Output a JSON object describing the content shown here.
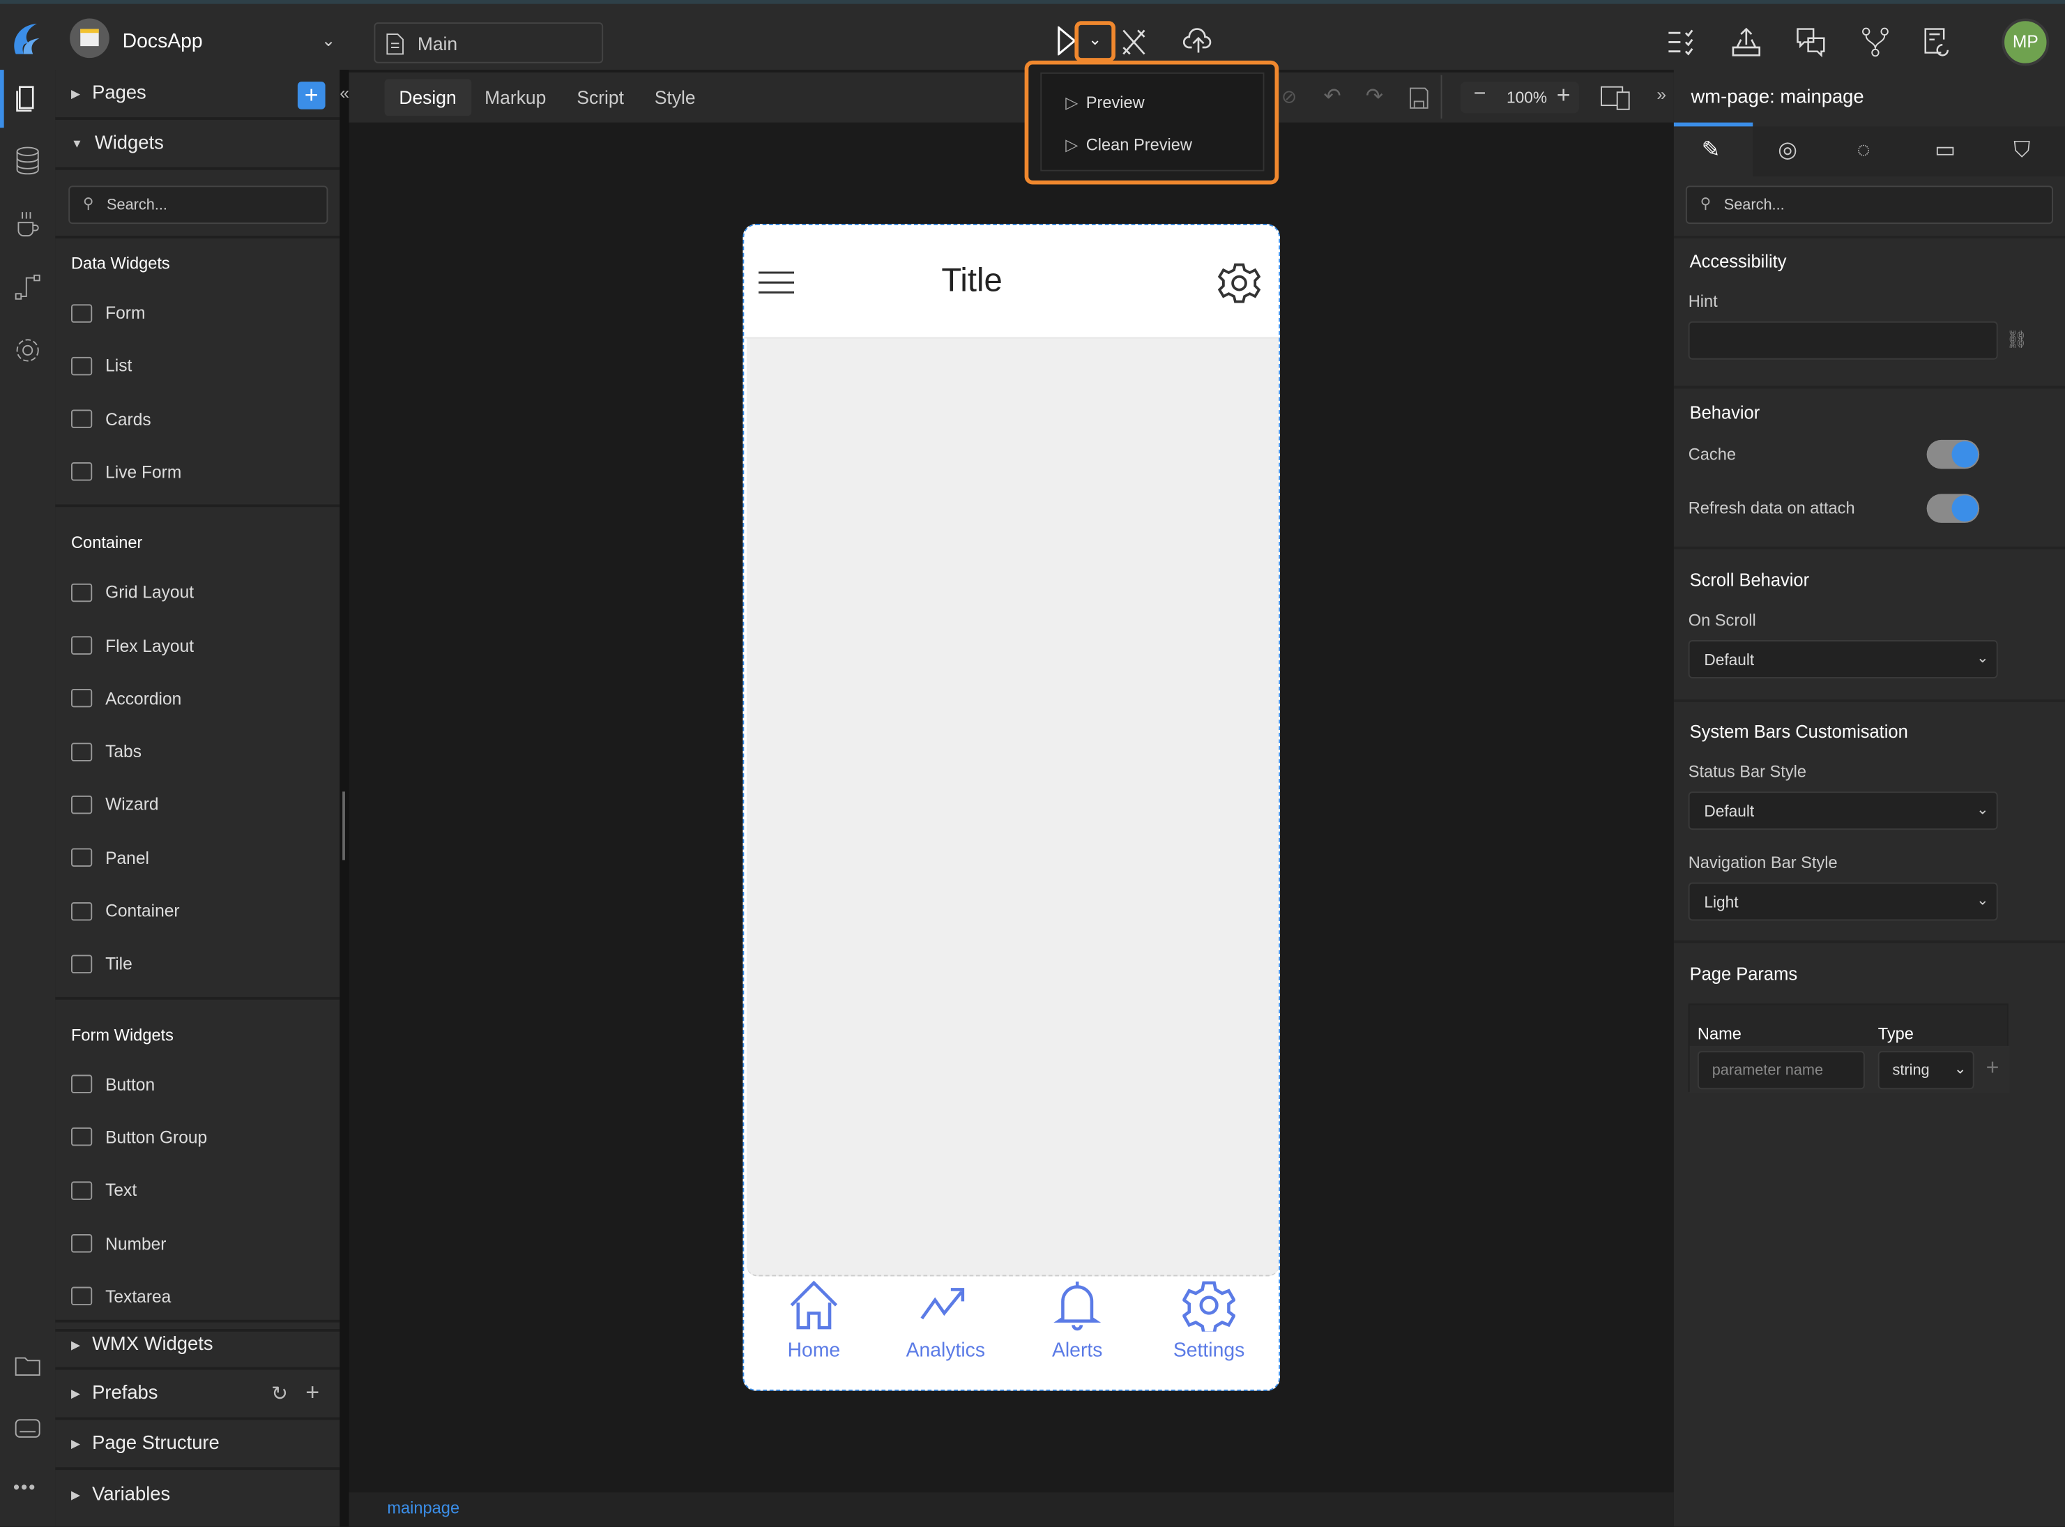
{
  "header": {
    "app_name": "DocsApp",
    "page_selector": "Main",
    "avatar_initials": "MP",
    "brand_color": "#3b8ee8",
    "avatar_color": "#6fa24f",
    "highlight_color": "#f0882e"
  },
  "preview_menu": {
    "items": [
      "Preview",
      "Clean Preview"
    ]
  },
  "left_panel": {
    "pages_label": "Pages",
    "widgets_label": "Widgets",
    "search_placeholder": "Search...",
    "groups": [
      {
        "title": "Data Widgets",
        "items": [
          "Form",
          "List",
          "Cards",
          "Live Form"
        ]
      },
      {
        "title": "Container",
        "items": [
          "Grid Layout",
          "Flex Layout",
          "Accordion",
          "Tabs",
          "Wizard",
          "Panel",
          "Container",
          "Tile"
        ]
      },
      {
        "title": "Form Widgets",
        "items": [
          "Button",
          "Button Group",
          "Text",
          "Number",
          "Textarea"
        ]
      }
    ],
    "sections": [
      "WMX Widgets",
      "Prefabs",
      "Page Structure",
      "Variables"
    ]
  },
  "editor": {
    "tabs": [
      "Design",
      "Markup",
      "Script",
      "Style"
    ],
    "active_tab": "Design",
    "zoom": "100%",
    "status_link": "mainpage"
  },
  "phone": {
    "title": "Title",
    "nav": [
      "Home",
      "Analytics",
      "Alerts",
      "Settings"
    ],
    "nav_color": "#5b7be6"
  },
  "right_panel": {
    "title": "wm-page: mainpage",
    "search_placeholder": "Search...",
    "accessibility": {
      "heading": "Accessibility",
      "hint_label": "Hint",
      "hint_value": ""
    },
    "behavior": {
      "heading": "Behavior",
      "cache_label": "Cache",
      "cache_on": true,
      "refresh_label": "Refresh data on attach",
      "refresh_on": true
    },
    "scroll": {
      "heading": "Scroll Behavior",
      "on_scroll_label": "On Scroll",
      "on_scroll_value": "Default"
    },
    "system_bars": {
      "heading": "System Bars Customisation",
      "status_label": "Status Bar Style",
      "status_value": "Default",
      "nav_label": "Navigation Bar Style",
      "nav_value": "Light"
    },
    "page_params": {
      "heading": "Page Params",
      "col_name": "Name",
      "col_type": "Type",
      "name_placeholder": "parameter name",
      "type_value": "string"
    }
  }
}
